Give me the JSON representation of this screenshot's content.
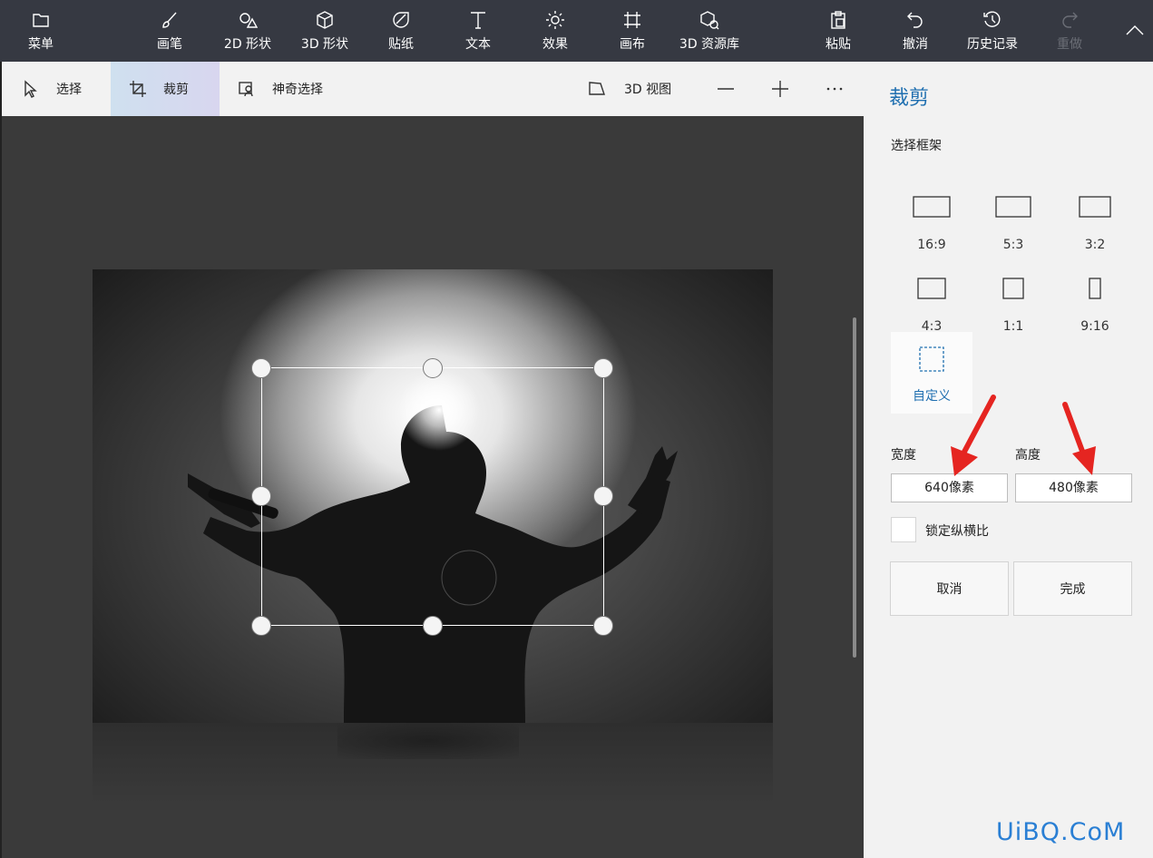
{
  "ribbon": {
    "menu": "菜单",
    "brush": "画笔",
    "shapes2d": "2D 形状",
    "shapes3d": "3D 形状",
    "stickers": "贴纸",
    "text": "文本",
    "effects": "效果",
    "canvas": "画布",
    "library3d": "3D 资源库",
    "paste": "粘贴",
    "undo": "撤消",
    "history": "历史记录",
    "redo": "重做"
  },
  "subbar": {
    "select": "选择",
    "crop": "裁剪",
    "magic_select": "神奇选择",
    "view3d": "3D 视图"
  },
  "panel": {
    "title": "裁剪",
    "frame_label": "选择框架",
    "ratios": [
      "16:9",
      "5:3",
      "3:2",
      "4:3",
      "1:1",
      "9:16"
    ],
    "custom": "自定义",
    "width_label": "宽度",
    "height_label": "高度",
    "width_value": "640像素",
    "height_value": "480像素",
    "lock_aspect": "锁定纵横比",
    "cancel": "取消",
    "done": "完成"
  },
  "colors": {
    "ribbon_bg": "#363942",
    "accent": "#1f6fb0",
    "arrow": "#e52521"
  },
  "watermark": "UiBQ.CoM"
}
